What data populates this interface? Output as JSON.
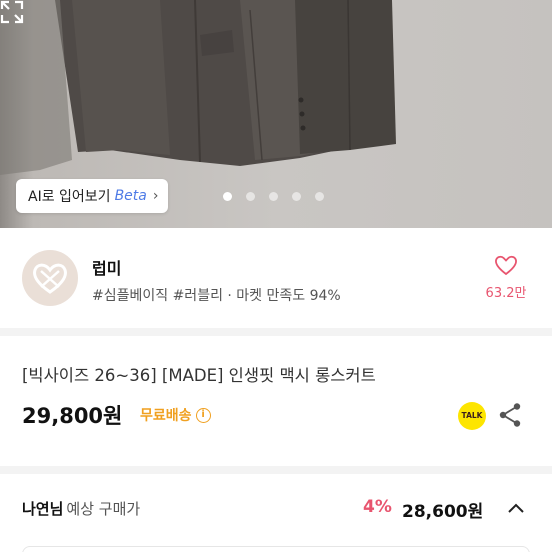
{
  "photo": {
    "ai_button": {
      "label": "AI로 입어보기",
      "beta": "Beta",
      "chevron": "›"
    },
    "carousel": {
      "total": 5,
      "active": 1
    },
    "expand_icon": "expand-icon"
  },
  "shop": {
    "name": "럽미",
    "tags": "#심플베이직 #러블리 · 마켓 만족도 94%",
    "likes": "63.2만",
    "logo_icon": "heart-logo-icon",
    "like_icon": "heart-outline-icon"
  },
  "product": {
    "title": "[빅사이즈 26~36] [MADE] 인생핏 맥시 롱스커트",
    "price": "29,800원",
    "shipping": "무료배송",
    "shipping_info_icon": "i",
    "talk_label": "TALK",
    "share_icon": "share-icon"
  },
  "expected": {
    "user": "나연님",
    "label": "예상 구매가",
    "discount": "4%",
    "price": "28,600원",
    "chevron_icon": "chevron-up-icon"
  },
  "colors": {
    "accent_pink": "#e8556f",
    "shipping_orange": "#f0a020",
    "beta_blue": "#4e7be6",
    "kakao_yellow": "#fde500"
  }
}
